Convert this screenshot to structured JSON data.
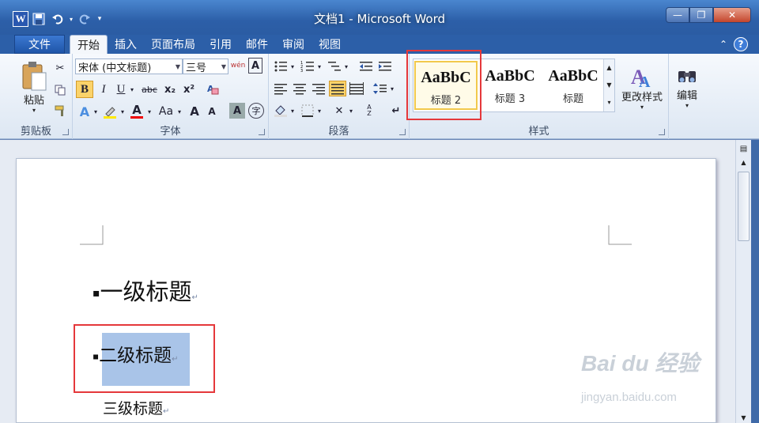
{
  "window": {
    "title": "文档1 - Microsoft Word",
    "minimize": "—",
    "maximize": "❐",
    "close": "✕"
  },
  "qat": {
    "logo": "W",
    "save_icon": "save-icon",
    "undo_icon": "undo-icon",
    "redo_icon": "redo-icon"
  },
  "tabs": {
    "file": "文件",
    "items": [
      "开始",
      "插入",
      "页面布局",
      "引用",
      "邮件",
      "审阅",
      "视图"
    ],
    "help": "?"
  },
  "clipboard": {
    "label": "剪贴板",
    "paste": "粘贴"
  },
  "font": {
    "label": "字体",
    "name": "宋体 (中文标题)",
    "size": "三号",
    "bold": "B",
    "italic": "I",
    "underline": "U",
    "strike": "abc",
    "sub": "x₂",
    "sup": "x²",
    "grow": "A",
    "shrink": "A",
    "change_case": "Aa",
    "clear": "A",
    "wen": "wén",
    "color_a": "A"
  },
  "paragraph": {
    "label": "段落"
  },
  "styles": {
    "label": "样式",
    "items": [
      {
        "preview": "AaBbC",
        "name": "标题 2"
      },
      {
        "preview": "AaBbC",
        "name": "标题 3"
      },
      {
        "preview": "AaBbC",
        "name": "标题"
      }
    ],
    "change": "更改样式"
  },
  "editing": {
    "label": "编辑"
  },
  "document": {
    "lines": [
      "一级标题",
      "二级标题",
      "三级标题"
    ]
  },
  "watermark": {
    "main": "Bai du 经验",
    "sub": "jingyan.baidu.com"
  },
  "colors": {
    "accent": "#2c5fa8",
    "selection": "#a9c4e8",
    "highlight": "#e5383b"
  }
}
